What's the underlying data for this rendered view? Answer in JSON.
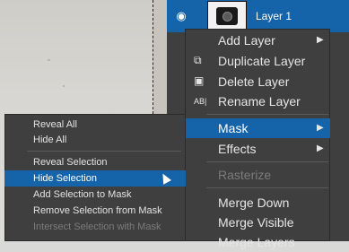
{
  "layers": {
    "items": [
      {
        "name": "Layer 1",
        "visible_icon": "eye-icon",
        "thumbnail_icon": "camera-thumbnail"
      }
    ]
  },
  "context_menu": {
    "items": [
      {
        "label": "Add Layer",
        "submenu": true
      },
      {
        "label": "Duplicate Layer",
        "icon": "duplicate-icon"
      },
      {
        "label": "Delete Layer",
        "icon": "trash-icon"
      },
      {
        "label": "Rename Layer",
        "icon": "rename-icon"
      },
      {
        "label": "Mask",
        "submenu": true,
        "selected": true
      },
      {
        "label": "Effects",
        "submenu": true
      },
      {
        "label": "Rasterize",
        "disabled": true
      },
      {
        "label": "Merge Down"
      },
      {
        "label": "Merge Visible"
      },
      {
        "label": "Merge Layers"
      }
    ]
  },
  "mask_submenu": {
    "items": [
      {
        "label": "Reveal All"
      },
      {
        "label": "Hide All"
      },
      {
        "label": "Reveal Selection"
      },
      {
        "label": "Hide Selection",
        "selected": true
      },
      {
        "label": "Add Selection to Mask"
      },
      {
        "label": "Remove Selection from Mask"
      },
      {
        "label": "Intersect Selection with Mask",
        "disabled": true
      }
    ]
  },
  "colors": {
    "menu_bg": "#3f3f3f",
    "accent": "#1563a8",
    "text": "#e6e6e6",
    "disabled": "#7b7b7b"
  }
}
